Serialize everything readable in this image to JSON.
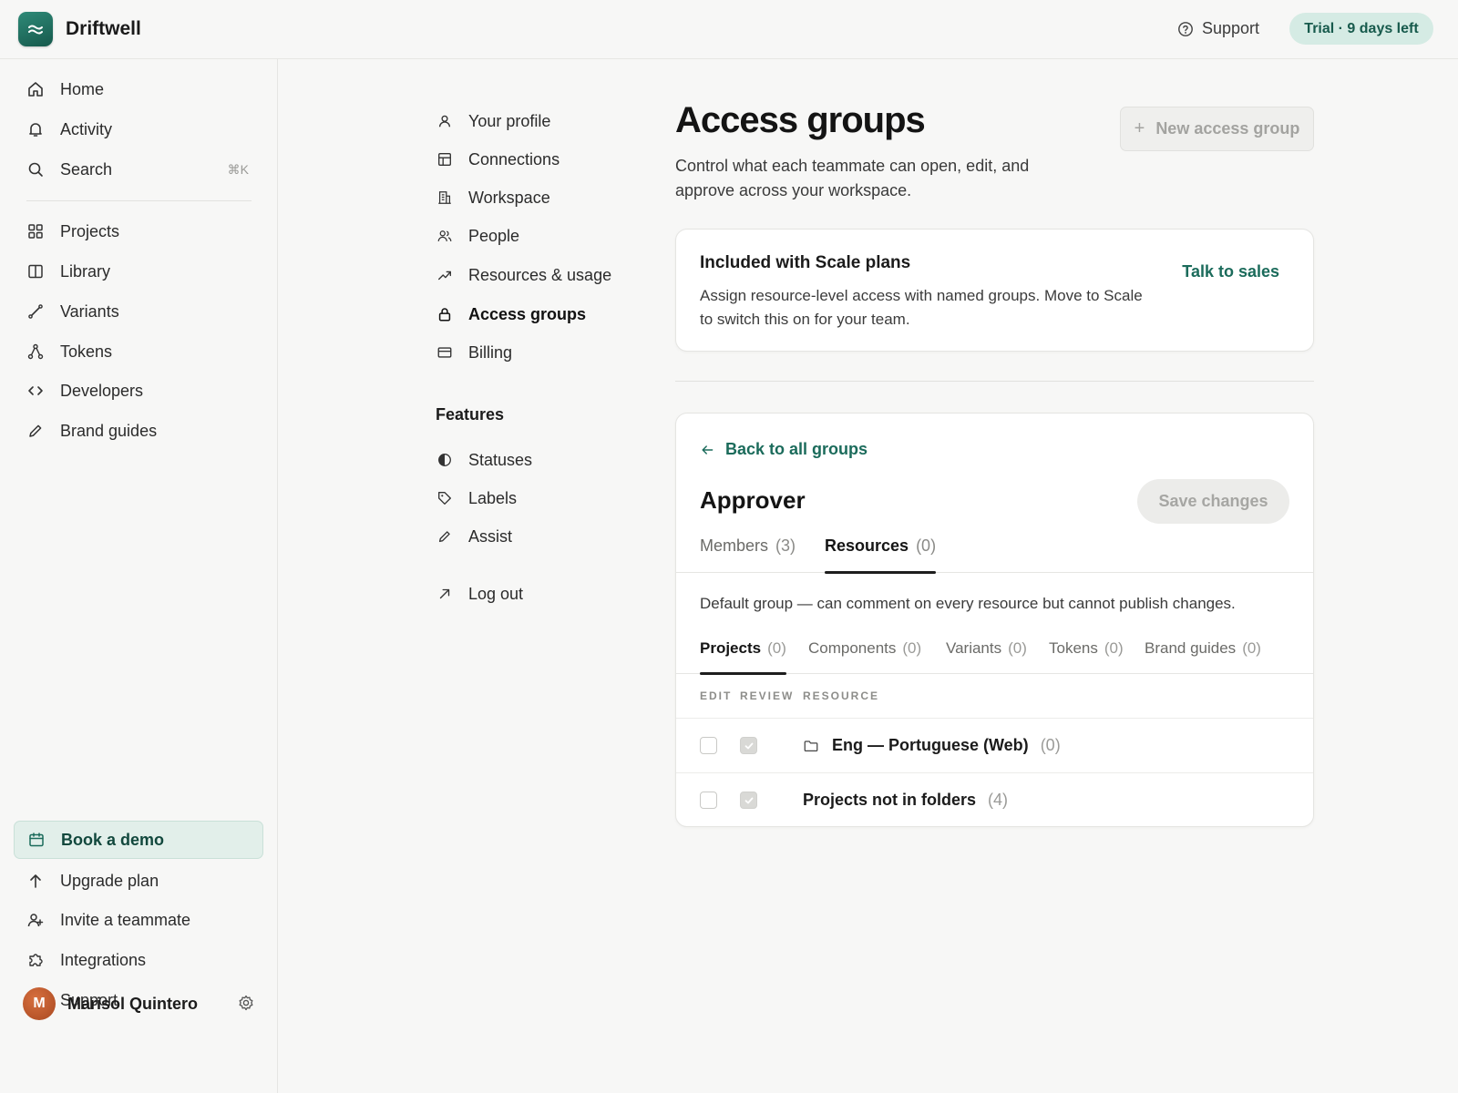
{
  "app": {
    "name": "Driftwell"
  },
  "topbar": {
    "support_label": "Support",
    "trial_label": "Trial · 9 days left"
  },
  "sidebar": {
    "primary": [
      {
        "label": "Home",
        "icon": "home-icon"
      },
      {
        "label": "Activity",
        "icon": "bell-icon"
      },
      {
        "label": "Search",
        "icon": "search-icon",
        "shortcut": "⌘K"
      }
    ],
    "secondary": [
      {
        "label": "Projects",
        "icon": "grid-icon"
      },
      {
        "label": "Library",
        "icon": "book-icon"
      },
      {
        "label": "Variants",
        "icon": "pen-tool-icon"
      },
      {
        "label": "Tokens",
        "icon": "share-nodes-icon"
      },
      {
        "label": "Developers",
        "icon": "code-icon"
      },
      {
        "label": "Brand guides",
        "icon": "pencil-icon"
      }
    ],
    "bottom": [
      {
        "label": "Book a demo",
        "icon": "calendar-icon"
      },
      {
        "label": "Upgrade plan",
        "icon": "arrow-up-icon"
      },
      {
        "label": "Invite a teammate",
        "icon": "user-plus-icon"
      },
      {
        "label": "Integrations",
        "icon": "puzzle-icon"
      },
      {
        "label": "Support",
        "icon": "help-circle-icon"
      }
    ],
    "user": {
      "name": "Marisol Quintero",
      "initial": "M"
    }
  },
  "settings_nav": {
    "items": [
      {
        "label": "Your profile",
        "icon": "user-icon"
      },
      {
        "label": "Connections",
        "icon": "table-icon"
      },
      {
        "label": "Workspace",
        "icon": "building-icon"
      },
      {
        "label": "People",
        "icon": "users-icon"
      },
      {
        "label": "Resources & usage",
        "icon": "trending-up-icon"
      },
      {
        "label": "Access groups",
        "icon": "lock-icon",
        "active": true
      },
      {
        "label": "Billing",
        "icon": "credit-card-icon"
      }
    ],
    "features_heading": "Features",
    "features": [
      {
        "label": "Statuses",
        "icon": "half-circle-icon"
      },
      {
        "label": "Labels",
        "icon": "tag-icon"
      },
      {
        "label": "Assist",
        "icon": "pencil-icon"
      }
    ],
    "logout_label": "Log out"
  },
  "main": {
    "title": "Access groups",
    "description": "Control what each teammate can open, edit, and approve across your workspace.",
    "new_group_label": "New access group",
    "upsell": {
      "title": "Included with Scale plans",
      "text": "Assign resource-level access with named groups. Move to Scale to switch this on for your team.",
      "cta": "Talk to sales"
    },
    "group": {
      "back_label": "Back to all groups",
      "name": "Approver",
      "save_label": "Save changes",
      "tabs": [
        {
          "label": "Members",
          "count": "(3)"
        },
        {
          "label": "Resources",
          "count": "(0)",
          "active": true
        }
      ],
      "description": "Default group — can comment on every resource but cannot publish changes.",
      "subtabs": [
        {
          "label": "Projects",
          "count": "(0)",
          "active": true
        },
        {
          "label": "Components",
          "count": "(0)"
        },
        {
          "label": "Variants",
          "count": "(0)"
        },
        {
          "label": "Tokens",
          "count": "(0)"
        },
        {
          "label": "Brand guides",
          "count": "(0)"
        }
      ],
      "columns": {
        "edit": "EDIT",
        "review": "REVIEW",
        "resource": "RESOURCE"
      },
      "rows": [
        {
          "name": "Eng — Portuguese (Web)",
          "count": "(0)",
          "icon": "folder-icon",
          "edit": false,
          "review": true
        },
        {
          "name": "Projects not in folders",
          "count": "(4)",
          "edit": false,
          "review": true
        }
      ]
    }
  },
  "colors": {
    "accent": "#1b6b5b",
    "badge_bg": "#d5ebe4",
    "background": "#f7f7f6"
  }
}
